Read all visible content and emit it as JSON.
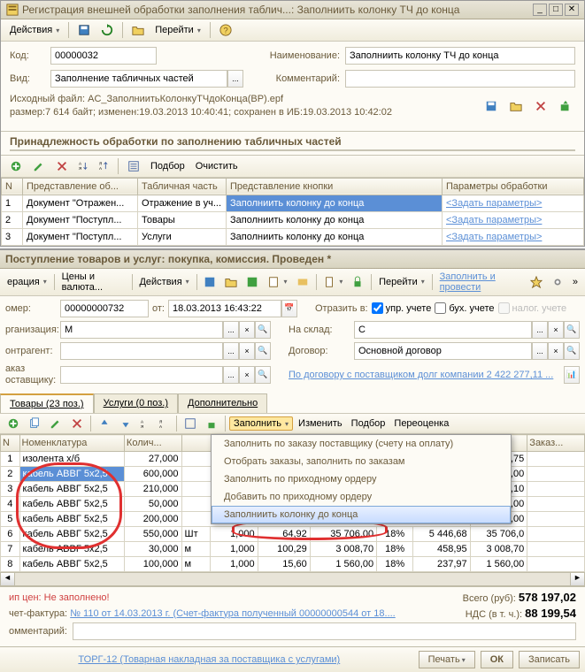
{
  "win1": {
    "title": "Регистрация внешней обработки заполнения таблич...: Заполниить колонку ТЧ до конца",
    "toolbar": {
      "actions": "Действия",
      "goto": "Перейти"
    },
    "form": {
      "code_lbl": "Код:",
      "code": "00000032",
      "name_lbl": "Наименование:",
      "name": "Заполниить колонку ТЧ до конца",
      "type_lbl": "Вид:",
      "type": "Заполнение табличных частей",
      "comment_lbl": "Комментарий:",
      "comment": "",
      "file_info": "Исходный файл: AС_ЗаполниитьКолонкуТЧдоКонца(ВР).epf\nразмер:7 614 байт; изменен:19.03.2013 10:40:41; сохранен в ИБ:19.03.2013 10:42:02"
    },
    "section": "Принадлежность обработки по заполнению табличных частей",
    "grid_toolbar": {
      "select": "Подбор",
      "clear": "Очистить"
    },
    "grid": {
      "headers": [
        "N",
        "Представление об...",
        "Табличная часть",
        "Представление кнопки",
        "Параметры обработки"
      ],
      "rows": [
        {
          "n": "1",
          "obj": "Документ \"Отражен...",
          "part": "Отражение в уч...",
          "btn": "Заполниить колонку до конца",
          "params": "<Задать параметры>"
        },
        {
          "n": "2",
          "obj": "Документ \"Поступл...",
          "part": "Товары",
          "btn": "Заполниить колонку до конца",
          "params": "<Задать параметры>"
        },
        {
          "n": "3",
          "obj": "Документ \"Поступл...",
          "part": "Услуги",
          "btn": "Заполниить колонку до конца",
          "params": "<Задать параметры>"
        }
      ]
    }
  },
  "win2": {
    "title": "Поступление товаров и услуг: покупка, комиссия. Проведен *",
    "toolbar": {
      "op": "ерация",
      "prices": "Цены и валюта...",
      "actions": "Действия",
      "goto": "Перейти",
      "fill_post": "Заполнить и провести"
    },
    "form": {
      "num_lbl": "омер:",
      "num": "00000000732",
      "date_lbl": "от:",
      "date": "18.03.2013 16:43:22",
      "reflect_lbl": "Отразить в:",
      "chk_upr": "упр. учете",
      "chk_buh": "бух. учете",
      "chk_nalog": "налог. учете",
      "org_lbl": "рганизация:",
      "org": "М",
      "stock_lbl": "На склад:",
      "stock": "С",
      "contr_lbl": "онтрагент:",
      "contr": "",
      "dogovor_lbl": "Договор:",
      "dogovor": "Основной договор",
      "zakaz_lbl": "аказ\nоставщику:",
      "zakaz": "",
      "debt": "По договору с поставщиком долг компании 2 422 277,11 ..."
    },
    "tabs": {
      "t1": "Товары (23 поз.)",
      "t2": "Услуги (0 поз.)",
      "t3": "Дополнительно"
    },
    "item_tb": {
      "fill": "Заполнить",
      "change": "Изменить",
      "select": "Подбор",
      "reprice": "Переоценка"
    },
    "menu": [
      "Заполнить по заказу поставщику (счету на оплату)",
      "Отобрать заказы, заполнить по заказам",
      "Заполнить по приходному ордеру",
      "Добавить по приходному ордеру",
      "Заполниить колонку до конца"
    ],
    "item_grid": {
      "headers": [
        "N",
        "Номенклатура",
        "Колич...",
        "",
        "",
        "",
        "",
        "",
        "",
        "",
        "Заказ..."
      ],
      "rows": [
        {
          "n": "1",
          "nom": "изолента x/б",
          "qty": "27,000",
          "v6": "",
          "v7": "",
          "v8": "",
          "v9": "",
          "v10": "95,75",
          "z": ""
        },
        {
          "n": "2",
          "nom": "кабель АВВГ 5x2,5",
          "qty": "600,000",
          "v6": "",
          "v7": "",
          "v8": "",
          "v9": "",
          "v10": "50,00",
          "z": ""
        },
        {
          "n": "3",
          "nom": "кабель АВВГ 5x2,5",
          "qty": "210,000",
          "v6": "",
          "v7": "",
          "v8": "",
          "v9": "",
          "v10": "26,10",
          "z": ""
        },
        {
          "n": "4",
          "nom": "кабель АВВГ 5x2,5",
          "qty": "50,000",
          "v6": "",
          "v7": "",
          "v8": "",
          "v9": "",
          "v10": "67,00",
          "z": ""
        },
        {
          "n": "5",
          "nom": "кабель АВВГ 5x2,5",
          "qty": "200,000",
          "v6": "",
          "v7": "",
          "v8": "",
          "v9": "",
          "v10": "02,00",
          "z": ""
        },
        {
          "n": "6",
          "nom": "кабель АВВГ 5x2,5",
          "qty": "550,000",
          "u": "Шт",
          "c1": "1,000",
          "c2": "64,92",
          "c3": "35 706,00",
          "c4": "18%",
          "c5": "5 446,68",
          "c6": "35 706,0"
        },
        {
          "n": "7",
          "nom": "кабель АВВГ 5x2,5",
          "qty": "30,000",
          "u": "м",
          "c1": "1,000",
          "c2": "100,29",
          "c3": "3 008,70",
          "c4": "18%",
          "c5": "458,95",
          "c6": "3 008,70"
        },
        {
          "n": "8",
          "nom": "кабель АВВГ 5x2,5",
          "qty": "100,000",
          "u": "м",
          "c1": "1,000",
          "c2": "15,60",
          "c3": "1 560,00",
          "c4": "18%",
          "c5": "237,97",
          "c6": "1 560,00"
        }
      ]
    },
    "footer": {
      "err": "ип цен: Не заполнено!",
      "total_lbl": "Всего (руб):",
      "total": "578 197,02",
      "chet_lbl": "чет-фактура:",
      "chet": "№ 110 от 14.03.2013 г. (Счет-фактура полученный 00000000544 от 18....",
      "nds_lbl": "НДС (в т. ч.):",
      "nds": "88 199,54",
      "comment_lbl": "омментарий:",
      "comment": ""
    },
    "bottom": {
      "torg": "ТОРГ-12 (Товарная накладная за поставщика с услугами)",
      "print": "Печать",
      "ok": "ОК",
      "save": "Записать"
    }
  }
}
